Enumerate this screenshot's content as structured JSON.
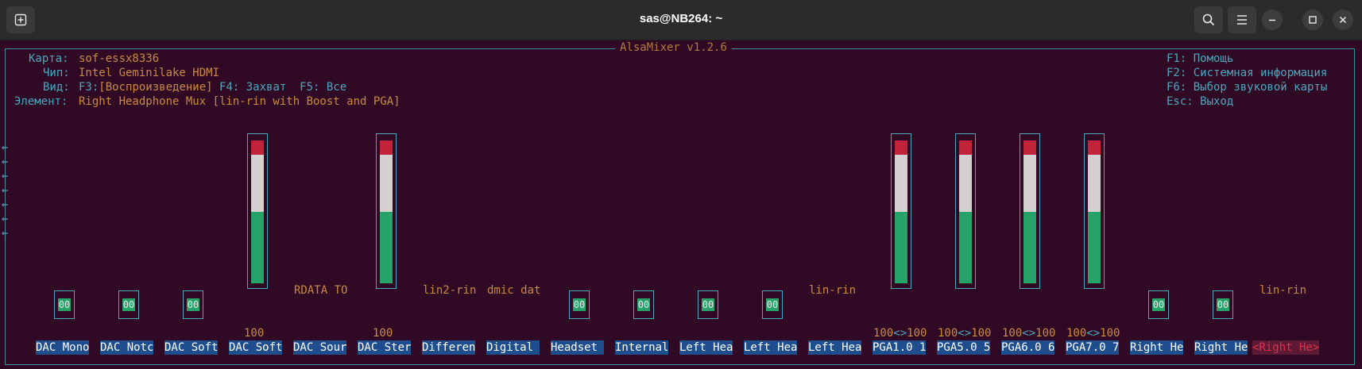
{
  "window": {
    "title": "sas@NB264: ~",
    "icons": [
      "new-tab-icon",
      "search-icon",
      "menu-icon",
      "minimize-icon",
      "maximize-icon",
      "close-icon"
    ]
  },
  "mixer": {
    "header": "AlsaMixer v1.2.6",
    "info": [
      {
        "label": "Карта:",
        "value": "sof-essx8336"
      },
      {
        "label": "Чип:",
        "value": "Intel Geminilake HDMI"
      },
      {
        "label": "Вид:",
        "value_cyan": "F3:",
        "value": "[Воспроизведение]",
        "value2": " F4: Захват  F5: Все"
      },
      {
        "label": "Элемент:",
        "value": "Right Headphone Mux [lin-rin with Boost and PGA]"
      }
    ],
    "help": [
      "F1: Помощь",
      "F2: Системная информация",
      "F6: Выбор звуковой карты",
      "Esc: Выход"
    ],
    "arrows": [
      "←",
      "←",
      "←",
      "←",
      "←",
      "←",
      "←"
    ]
  },
  "controls": [
    {
      "name": "DAC Mono",
      "switch": "00"
    },
    {
      "name": "DAC Notc",
      "switch": "00"
    },
    {
      "name": "DAC Soft",
      "switch": "00"
    },
    {
      "name": "DAC Soft",
      "value": "100",
      "level": 1.0
    },
    {
      "name": "DAC Sour",
      "sub": "RDATA TO"
    },
    {
      "name": "DAC Ster",
      "value": "100",
      "level": 1.0
    },
    {
      "name": "Differen",
      "sub": "lin2-rin"
    },
    {
      "name": "Digital ",
      "sub": "dmic dat"
    },
    {
      "name": "Headset ",
      "switch": "00"
    },
    {
      "name": "Internal",
      "switch": "00"
    },
    {
      "name": "Left Hea",
      "switch": "00"
    },
    {
      "name": "Left Hea",
      "switch": "00"
    },
    {
      "name": "Left Hea",
      "sub": "lin-rin"
    },
    {
      "name": "PGA1.0 1",
      "value_l": "100",
      "value_sep": "<>",
      "value_r": "100",
      "level": 1.0
    },
    {
      "name": "PGA5.0 5",
      "value_l": "100",
      "value_sep": "<>",
      "value_r": "100",
      "level": 1.0
    },
    {
      "name": "PGA6.0 6",
      "value_l": "100",
      "value_sep": "<>",
      "value_r": "100",
      "level": 1.0
    },
    {
      "name": "PGA7.0 7",
      "value_l": "100",
      "value_sep": "<>",
      "value_r": "100",
      "level": 1.0
    },
    {
      "name": "Right He",
      "switch": "00"
    },
    {
      "name": "Right He",
      "switch": "00"
    },
    {
      "name": "<Right He>",
      "sub": "lin-rin",
      "selected": true
    }
  ]
}
